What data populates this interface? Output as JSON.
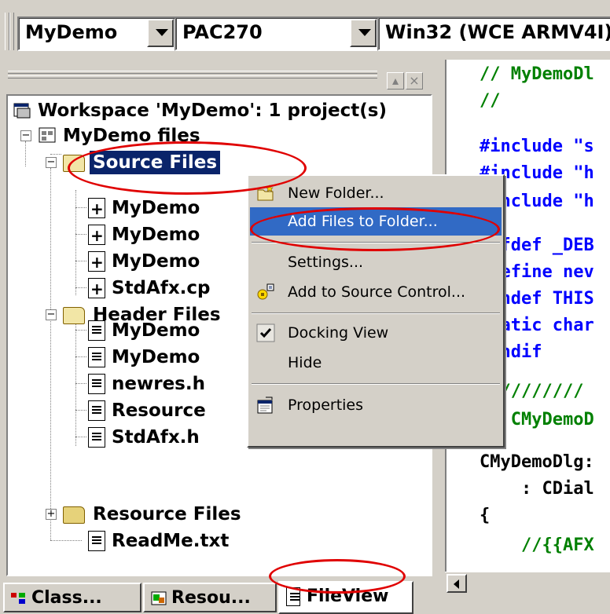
{
  "toolbar": {
    "project_combo": "MyDemo",
    "platform_combo": "PAC270",
    "config_combo": "Win32 (WCE ARMV4I)"
  },
  "workspace": {
    "root_label": "Workspace 'MyDemo': 1 project(s)",
    "project_label": "MyDemo files",
    "source_folder": "Source Files",
    "source_files": [
      "MyDemo",
      "MyDemo",
      "MyDemo",
      "StdAfx.cp"
    ],
    "header_folder": "Header Files",
    "header_files": [
      "MyDemo",
      "MyDemo",
      "newres.h",
      "Resource",
      "StdAfx.h"
    ],
    "resource_folder": "Resource Files",
    "readme": "ReadMe.txt"
  },
  "tabs": [
    "Class...",
    "Resou...",
    "FileView"
  ],
  "active_tab": "FileView",
  "context_menu": {
    "items": [
      {
        "label": "New Folder...",
        "icon": "new-folder-icon"
      },
      {
        "label": "Add Files to Folder...",
        "highlighted": true
      },
      {
        "label": "Settings..."
      },
      {
        "label": "Add to Source Control...",
        "icon": "source-control-icon"
      },
      {
        "label": "Docking View",
        "checked": true
      },
      {
        "label": "Hide"
      },
      {
        "label": "Properties",
        "icon": "properties-icon"
      }
    ]
  },
  "code_lines": [
    {
      "text": "// MyDemoDl",
      "kind": "comment"
    },
    {
      "text": "//",
      "kind": "comment"
    },
    {
      "text": "#include \"s",
      "kind": "include"
    },
    {
      "text": "#include \"h",
      "kind": "include"
    },
    {
      "text": "#include \"h",
      "kind": "include"
    },
    {
      "text": "#ifdef _DEB",
      "kind": "directive"
    },
    {
      "text": "#define nev",
      "kind": "directive"
    },
    {
      "text": "#undef THIS",
      "kind": "directive"
    },
    {
      "text": "static char",
      "kind": "keyword"
    },
    {
      "text": "#endif",
      "kind": "directive"
    },
    {
      "text": "//////////",
      "kind": "comment"
    },
    {
      "text": "// CMyDemoD",
      "kind": "comment"
    },
    {
      "text": "CMyDemoDlg:",
      "kind": "plain"
    },
    {
      "text": "    : CDial",
      "kind": "plain"
    },
    {
      "text": "{",
      "kind": "plain"
    },
    {
      "text": "    //{{AFX",
      "kind": "comment"
    },
    {
      "text": "        ..",
      "kind": "comment"
    }
  ],
  "colors": {
    "annotation_ring": "#e00000",
    "selection": "#0a246a",
    "menu_highlight": "#316ac5",
    "comment": "#008000",
    "keyword": "#0000ff"
  }
}
